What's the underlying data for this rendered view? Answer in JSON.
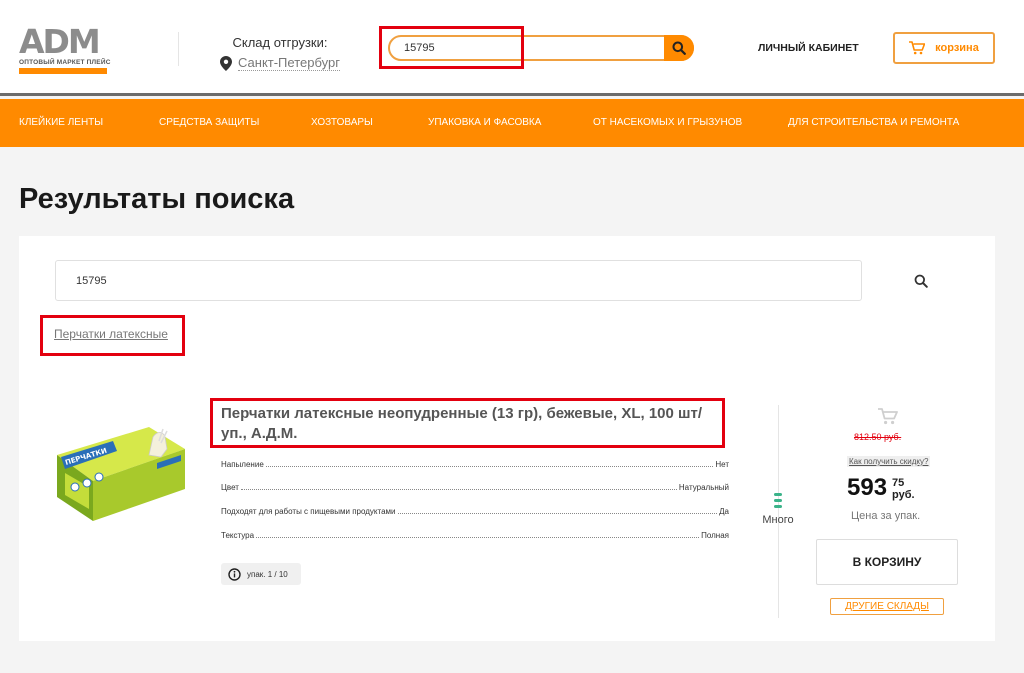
{
  "header": {
    "logo": {
      "mark": "ADM",
      "sub": "ОПТОВЫЙ МАРКЕТ ПЛЕЙС"
    },
    "warehouse_label": "Склад отгрузки:",
    "warehouse_city": "Санкт-Петербург",
    "search_value": "15795",
    "cabinet_label": "ЛИЧНЫЙ КАБИНЕТ",
    "cart_label": "корзина"
  },
  "nav": {
    "items": [
      "КЛЕЙКИЕ ЛЕНТЫ",
      "СРЕДСТВА ЗАЩИТЫ",
      "ХОЗТОВАРЫ",
      "УПАКОВКА И ФАСОВКА",
      "ОТ НАСЕКОМЫХ И ГРЫЗУНОВ",
      "ДЛЯ СТРОИТЕЛЬСТВА И РЕМОНТА"
    ]
  },
  "page": {
    "title": "Результаты поиска",
    "search_value": "15795",
    "suggestion": "Перчатки латексные"
  },
  "product": {
    "title": "Перчатки латексные неопудренные (13 гр), бежевые, XL, 100 шт/уп., А.Д.М.",
    "image_caption": "ПЕРЧАТКИ",
    "specs": [
      {
        "name": "Напыление",
        "value": "Нет"
      },
      {
        "name": "Цвет",
        "value": "Натуральный"
      },
      {
        "name": "Подходят для работы с пищевыми продуктами",
        "value": "Да"
      },
      {
        "name": "Текстура",
        "value": "Полная"
      }
    ],
    "pack": "упак. 1 / 10",
    "stock": "Много",
    "old_price": "812.50 руб.",
    "discount_link": "Как получить скидку?",
    "price_main": "593",
    "price_cents": "75",
    "price_currency": "руб.",
    "price_unit": "Цена за упак.",
    "add_to_cart": "В КОРЗИНУ",
    "other_warehouses": "ДРУГИЕ СКЛАДЫ"
  },
  "colors": {
    "accent": "#ff8a00",
    "highlight": "#e3000f",
    "old_price": "#e3000f",
    "stock": "#3bb38a"
  }
}
